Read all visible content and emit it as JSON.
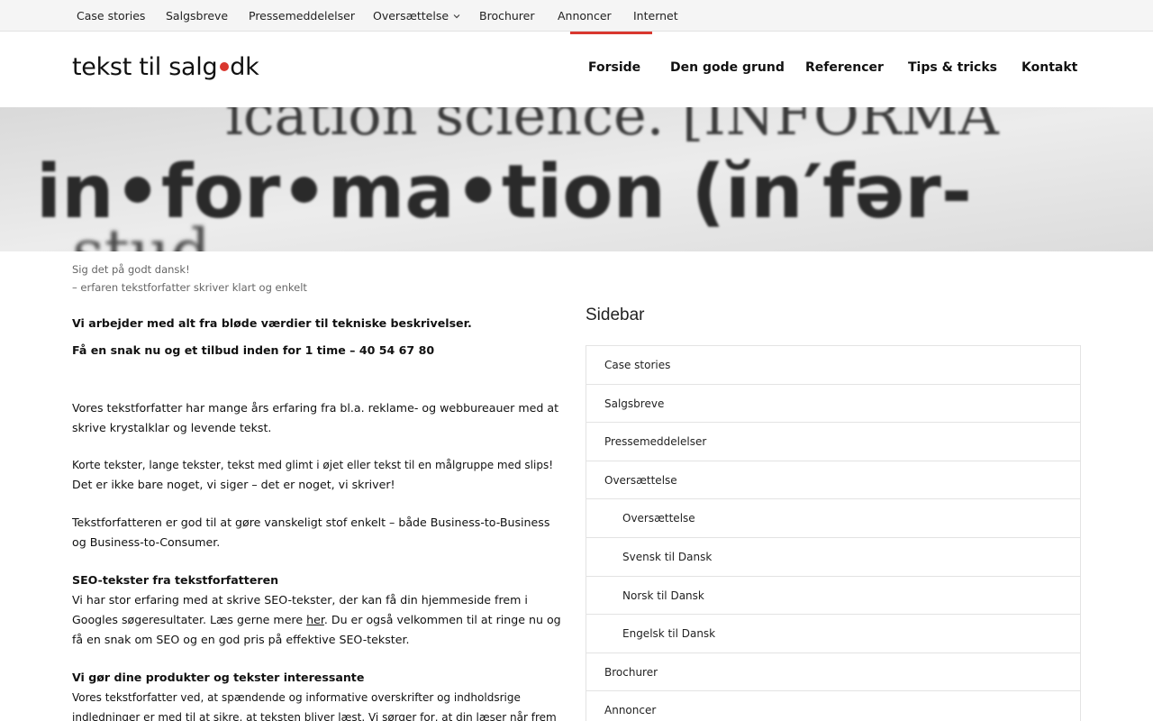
{
  "topbar": {
    "items": [
      "Case stories",
      "Salgsbreve",
      "Pressemeddelelser",
      "Oversættelse",
      "Brochurer",
      "Annoncer",
      "Internet"
    ]
  },
  "header": {
    "logo_left": "tekst til salg",
    "logo_right": "dk",
    "nav": [
      "Forside",
      "Den gode grund",
      "Referencer",
      "Tips & tricks",
      "Kontakt"
    ],
    "active_item": "Forside"
  },
  "hero": {
    "line1": "ication science. [INFORMA",
    "line2": "in•for•ma•tion (ĭn′fər-",
    "line3": "stud"
  },
  "tagline": {
    "line1": "Sig det på godt dansk!",
    "line2": "– erfaren tekstforfatter skriver klart og enkelt"
  },
  "content": {
    "intro1": "Vi arbejder med alt fra bløde værdier til tekniske beskrivelser.",
    "intro2": "Få en snak nu og et tilbud inden for 1 time – 40 54 67 80",
    "para1": "Vores tekstforfatter har mange års erfaring fra bl.a. reklame- og webbureauer med at skrive krystalklar og levende tekst.",
    "para2a": "Korte tekster, lange tekster, tekst med glimt i øjet eller tekst til en målgruppe med slips!",
    "para2b": "Det er ikke bare noget, vi siger – det er noget, vi skriver!",
    "para3": "Tekstforfatteren er god til at gøre vanskeligt stof enkelt – både Business-to-Business og Business-to-Consumer.",
    "seo_heading": "SEO-tekster fra tekstforfatteren",
    "seo_text_before": "Vi har stor erfaring med at skrive SEO-tekster, der kan få din hjemmeside frem i Googles søgeresultater. Læs gerne mere ",
    "seo_link": "her",
    "seo_text_after": ". Du er også velkommen til at ringe nu og få en snak om SEO og en god pris på effektive SEO-tekster.",
    "products_heading": "Vi gør dine produkter og tekster interessante",
    "products_text": "Vores tekstforfatter ved, at spændende og informative overskrifter og indholdsrige indledninger er med til at sikre, at teksten bliver læst. Vi sørger for, at din læser når frem til en effektiv Call-To-"
  },
  "sidebar": {
    "title": "Sidebar",
    "items": [
      {
        "label": "Case stories",
        "sub": false
      },
      {
        "label": "Salgsbreve",
        "sub": false
      },
      {
        "label": "Pressemeddelelser",
        "sub": false
      },
      {
        "label": "Oversættelse",
        "sub": false
      },
      {
        "label": "Oversættelse",
        "sub": true
      },
      {
        "label": "Svensk til Dansk",
        "sub": true
      },
      {
        "label": "Norsk til Dansk",
        "sub": true
      },
      {
        "label": "Engelsk til Dansk",
        "sub": true
      },
      {
        "label": "Brochurer",
        "sub": false
      },
      {
        "label": "Annoncer",
        "sub": false
      }
    ]
  },
  "colors": {
    "accent": "#d9372f",
    "topbar_bg": "#f5f5f5",
    "border": "#e3e3e3"
  }
}
